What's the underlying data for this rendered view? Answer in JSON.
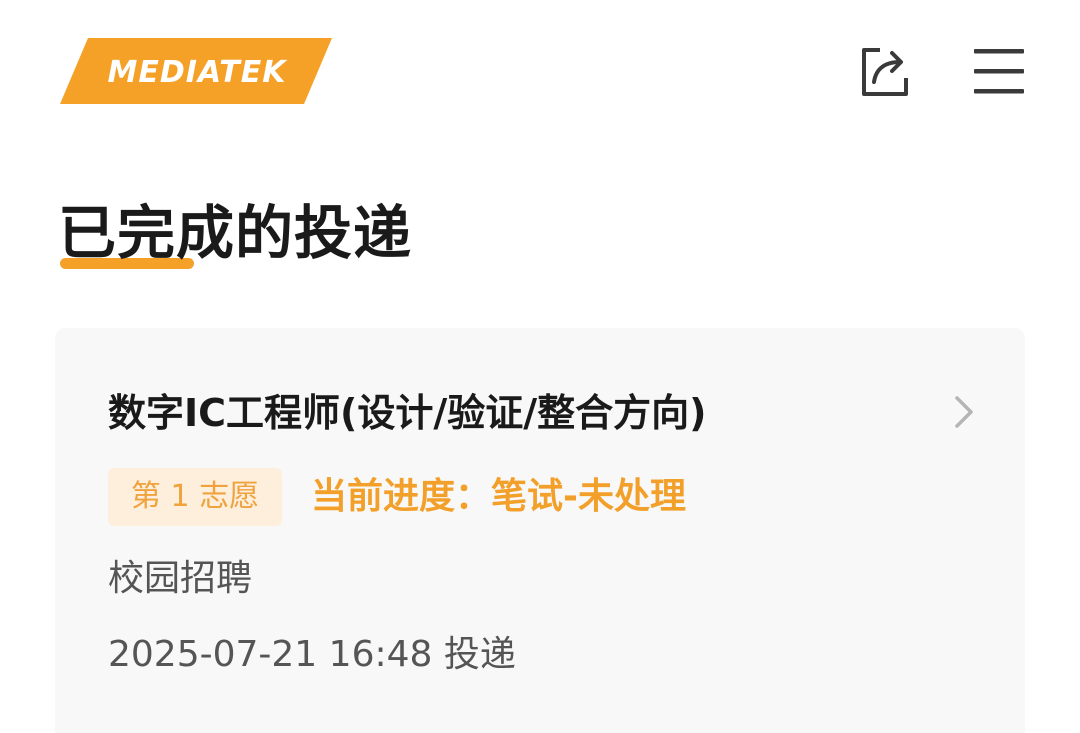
{
  "header": {
    "logo_text": "MEDIATEK",
    "share_icon": "share-icon",
    "menu_icon": "hamburger-menu-icon"
  },
  "page": {
    "title": "已完成的投递"
  },
  "applications": [
    {
      "job_title": "数字IC工程师(设计/验证/整合方向)",
      "preference": "第 1 志愿",
      "progress": "当前进度：笔试-未处理",
      "category": "校园招聘",
      "submitted": "2025-07-21 16:48 投递"
    }
  ],
  "colors": {
    "brand_orange": "#f5a128",
    "progress_text": "#f2a02a",
    "badge_bg": "#fdefdc",
    "card_bg": "#f8f8f8",
    "icon_dark": "#3a3a3a"
  }
}
